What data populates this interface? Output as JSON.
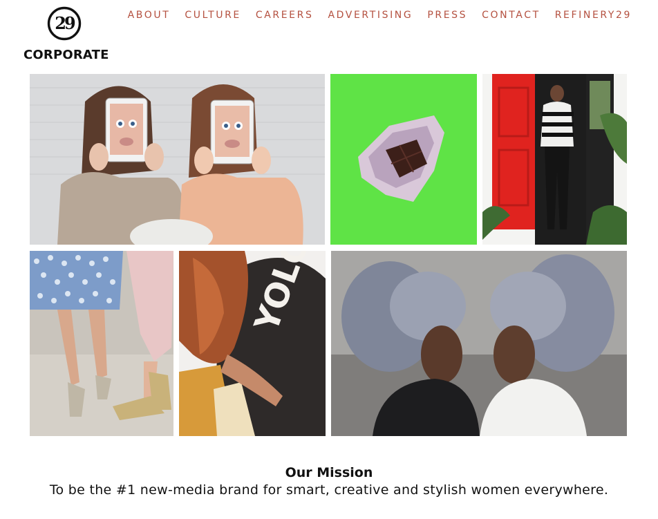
{
  "header": {
    "logo_mark": "29",
    "logo_word": "CORPORATE"
  },
  "nav": {
    "items": [
      {
        "label": "ABOUT"
      },
      {
        "label": "CULTURE"
      },
      {
        "label": "CAREERS"
      },
      {
        "label": "ADVERTISING"
      },
      {
        "label": "PRESS"
      },
      {
        "label": "CONTACT"
      },
      {
        "label": "REFINERY29"
      }
    ]
  },
  "gallery": {
    "tiles": [
      {
        "subject": "two women holding tablets over faces"
      },
      {
        "subject": "chocolate bar in foil on green background"
      },
      {
        "subject": "woman in striped sweater at red door"
      },
      {
        "subject": "legs in heels on sidewalk"
      },
      {
        "subject": "woman with auburn hair in graphic tee"
      },
      {
        "subject": "two women with silver afro hair facing each other"
      }
    ]
  },
  "mission": {
    "title": "Our Mission",
    "text": "To be the #1 new-media brand for smart, creative and stylish women everywhere."
  },
  "colors": {
    "nav": "#b4503f",
    "text": "#111111",
    "background": "#ffffff"
  }
}
